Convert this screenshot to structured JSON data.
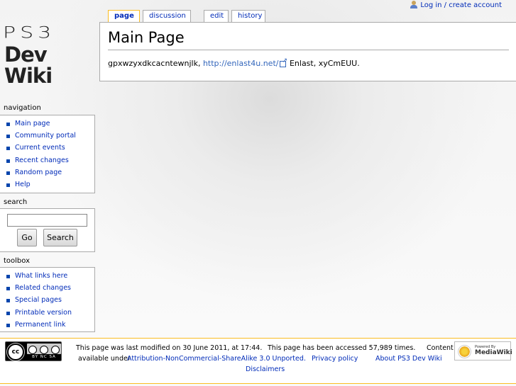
{
  "site": {
    "logo_top": "PS3",
    "logo_bottom": "Dev Wiki"
  },
  "personal_tools": {
    "login_label": "Log in / create account"
  },
  "tabs": [
    {
      "label": "page",
      "selected": true
    },
    {
      "label": "discussion"
    },
    {
      "label": "edit"
    },
    {
      "label": "history"
    }
  ],
  "page": {
    "title": "Main Page",
    "body_pre": "gpxwzyxdkcacntewnjlk, ",
    "body_link": "http://enlast4u.net/",
    "body_post": " Enlast, xyCmEUU."
  },
  "navigation": {
    "heading": "navigation",
    "items": [
      "Main page",
      "Community portal",
      "Current events",
      "Recent changes",
      "Random page",
      "Help"
    ]
  },
  "search": {
    "heading": "search",
    "input_value": "",
    "go_label": "Go",
    "search_label": "Search"
  },
  "toolbox": {
    "heading": "toolbox",
    "items": [
      "What links here",
      "Related changes",
      "Special pages",
      "Printable version",
      "Permanent link"
    ]
  },
  "footer": {
    "cc_icon_text": "cc",
    "cc_labels": "BY  NC  SA",
    "last_modified": "This page was last modified on 30 June 2011, at 17:44.",
    "accessed": "This page has been accessed 57,989 times.",
    "content_label": "Content is",
    "available_under": "available under",
    "license_link": "Attribution-NonCommercial-ShareAlike 3.0 Unported.",
    "privacy_link": "Privacy policy",
    "about_link": "About PS3 Dev Wiki",
    "disclaimers_link": "Disclaimers",
    "mw_small": "Powered By",
    "mw_big": "MediaWiki"
  },
  "colors": {
    "link": "#002bb8",
    "tab_selected_border": "#fabd23",
    "footer_border": "#fabd23"
  }
}
